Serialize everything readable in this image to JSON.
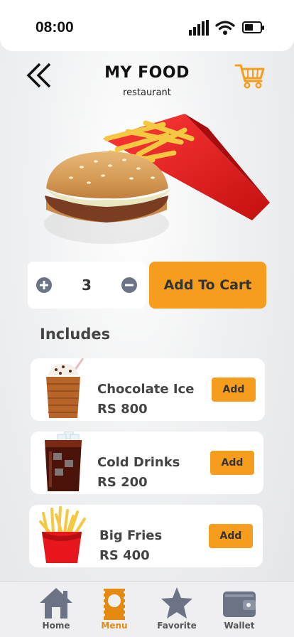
{
  "status_bar": {
    "time": "08:00"
  },
  "header": {
    "title": "MY FOOD",
    "subtitle": "restaurant"
  },
  "product": {
    "quantity": "3",
    "add_to_cart_label": "Add To Cart"
  },
  "includes": {
    "title": "Includes",
    "items": [
      {
        "name": "Chocolate Ice",
        "price": "RS 800",
        "add_label": "Add",
        "icon": "chocolate-drink-icon"
      },
      {
        "name": "Cold Drinks",
        "price": "RS 200",
        "add_label": "Add",
        "icon": "cola-glass-icon"
      },
      {
        "name": "Big Fries",
        "price": "RS 400",
        "add_label": "Add",
        "icon": "fries-icon"
      }
    ]
  },
  "tabbar": {
    "tabs": [
      {
        "label": "Home",
        "icon": "home-icon"
      },
      {
        "label": "Menu",
        "icon": "menu-icon",
        "active": true
      },
      {
        "label": "Favorite",
        "icon": "star-icon"
      },
      {
        "label": "Wallet",
        "icon": "wallet-icon"
      }
    ]
  },
  "colors": {
    "accent": "#f79d1e",
    "icon_gray": "#6b7385",
    "text": "#444444"
  }
}
